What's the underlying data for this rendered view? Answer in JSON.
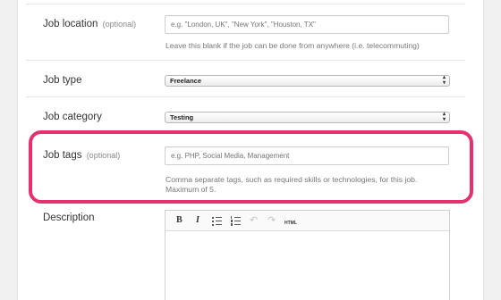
{
  "form": {
    "job_location": {
      "label": "Job location",
      "optional": "(optional)",
      "placeholder": "e.g. \"London, UK\", \"New York\", \"Houston, TX\"",
      "help": "Leave this blank if the job can be done from anywhere (i.e. telecommuting)"
    },
    "job_type": {
      "label": "Job type",
      "selected": "Freelance"
    },
    "job_category": {
      "label": "Job category",
      "selected": "Testing"
    },
    "job_tags": {
      "label": "Job tags",
      "optional": "(optional)",
      "placeholder": "e.g. PHP, Social Media, Management",
      "help_line1": "Comma separate tags, such as required skills or technologies, for this job.",
      "help_line2": "Maximum of 5."
    },
    "description": {
      "label": "Description",
      "toolbar": {
        "bold": "B",
        "italic": "I",
        "html": "HTML"
      }
    }
  },
  "colors": {
    "highlight": "#e6306f",
    "background": "#f0f0f0"
  },
  "icons": [
    "bullet-list-icon",
    "numbered-list-icon",
    "undo-icon",
    "redo-icon",
    "select-arrows-icon"
  ]
}
